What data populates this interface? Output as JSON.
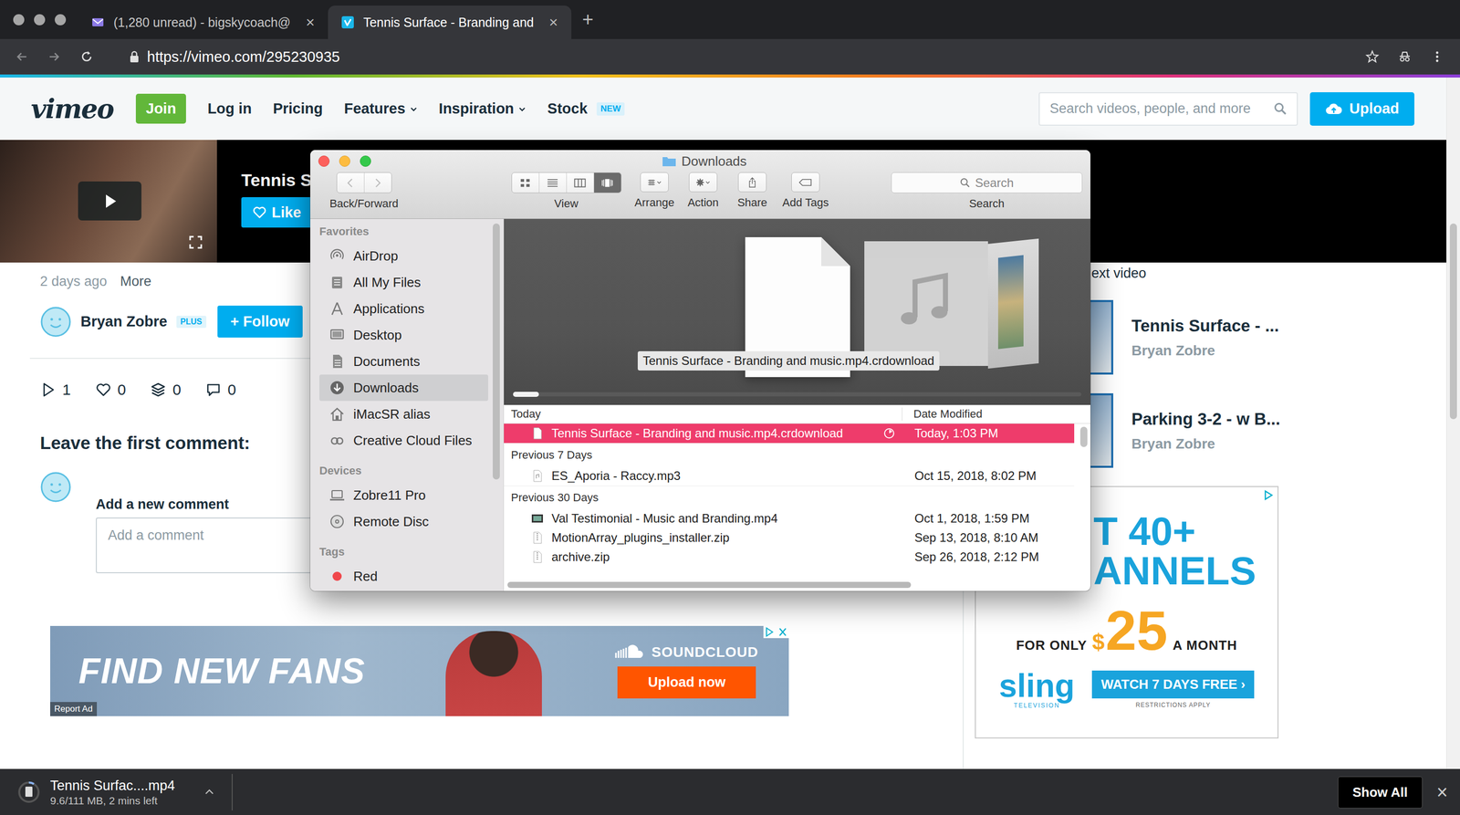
{
  "browser": {
    "tabs": [
      {
        "label": "(1,280 unread) - bigskycoach@",
        "close": "×",
        "kind": "mail",
        "selected": false
      },
      {
        "label": "Tennis Surface - Branding and",
        "close": "×",
        "kind": "vimeo",
        "selected": true
      }
    ],
    "new_tab": "+",
    "url": "https://vimeo.com/295230935"
  },
  "header": {
    "logo": "vimeo",
    "join": "Join",
    "nav": [
      {
        "label": "Log in",
        "dropdown": false
      },
      {
        "label": "Pricing",
        "dropdown": false
      },
      {
        "label": "Features",
        "dropdown": true
      },
      {
        "label": "Inspiration",
        "dropdown": true
      },
      {
        "label": "Stock",
        "dropdown": false,
        "badge": "NEW"
      }
    ],
    "search_placeholder": "Search videos, people, and more",
    "upload": "Upload"
  },
  "video": {
    "title": "Tennis S",
    "like": "Like"
  },
  "meta": {
    "posted": "2 days ago",
    "more": "More",
    "author": "Bryan Zobre",
    "badge": "PLUS",
    "follow_icon": "+",
    "follow": "Follow"
  },
  "stats": [
    {
      "kind": "plays",
      "count": "1"
    },
    {
      "kind": "likes",
      "count": "0"
    },
    {
      "kind": "collections",
      "count": "0"
    },
    {
      "kind": "comments",
      "count": "0"
    }
  ],
  "comments": {
    "heading": "Leave the first comment:",
    "label": "Add a new comment",
    "placeholder": "Add a comment"
  },
  "ad_banner": {
    "headline": "FIND NEW FANS",
    "brand": "SOUNDCLOUD",
    "cta": "Upload now",
    "report": "Report Ad"
  },
  "sidebar_right": {
    "label": "ext video",
    "related": [
      {
        "title": "Tennis Surface - ...",
        "author": "Bryan Zobre"
      },
      {
        "title": "Parking 3-2 - w B...",
        "author": "Bryan Zobre"
      }
    ]
  },
  "ad_side": {
    "line1": "T 40+",
    "line2": "ANNELS",
    "pre": "FOR ONLY",
    "currency": "$",
    "price": "25",
    "post": "A MONTH",
    "brand": "sling",
    "brand_sub": "TELEVISION",
    "cta": "WATCH 7 DAYS FREE",
    "cta_arrow": "›",
    "fine_print": "RESTRICTIONS APPLY"
  },
  "finder": {
    "title": "Downloads",
    "toolbar": {
      "back_forward": "Back/Forward",
      "view": "View",
      "view_modes": [
        {
          "mode": "icons",
          "selected": false
        },
        {
          "mode": "list",
          "selected": false
        },
        {
          "mode": "columns",
          "selected": false
        },
        {
          "mode": "coverflow",
          "selected": true
        }
      ],
      "arrange": "Arrange",
      "action": "Action",
      "share": "Share",
      "add_tags": "Add Tags",
      "search_placeholder": "Search",
      "search": "Search"
    },
    "sidebar": [
      {
        "heading": "Favorites",
        "items": [
          {
            "label": "AirDrop",
            "kind": "airdrop",
            "selected": false
          },
          {
            "label": "All My Files",
            "kind": "files",
            "selected": false
          },
          {
            "label": "Applications",
            "kind": "apps",
            "selected": false
          },
          {
            "label": "Desktop",
            "kind": "desktop",
            "selected": false
          },
          {
            "label": "Documents",
            "kind": "documents",
            "selected": false
          },
          {
            "label": "Downloads",
            "kind": "downloads",
            "selected": true
          },
          {
            "label": "iMacSR alias",
            "kind": "home",
            "selected": false
          },
          {
            "label": "Creative Cloud Files",
            "kind": "cloud",
            "selected": false
          }
        ]
      },
      {
        "heading": "Devices",
        "items": [
          {
            "label": "Zobre11 Pro",
            "kind": "laptop",
            "selected": false
          },
          {
            "label": "Remote Disc",
            "kind": "disc",
            "selected": false
          }
        ]
      },
      {
        "heading": "Tags",
        "items": [
          {
            "label": "Red",
            "kind": "tag",
            "color": "#f0474b",
            "selected": false
          }
        ]
      }
    ],
    "coverflow": {
      "caption": "Tennis Surface - Branding and music.mp4.crdownload",
      "items": [
        {
          "kind": "document",
          "selected": true
        },
        {
          "kind": "audio",
          "selected": false
        },
        {
          "kind": "video",
          "selected": false
        }
      ]
    },
    "date_column": "Date Modified",
    "groups": [
      {
        "label": "Today",
        "sticky": true,
        "rows": [
          {
            "name": "Tennis Surface - Branding and music.mp4.crdownload",
            "date": "Today, 1:03 PM",
            "kind": "download",
            "selected": true,
            "in_progress": true
          }
        ]
      },
      {
        "label": "Previous 7 Days",
        "sticky": false,
        "rows": [
          {
            "name": "ES_Aporia - Raccy.mp3",
            "date": "Oct 15, 2018, 8:02 PM",
            "kind": "audio",
            "selected": false,
            "in_progress": false
          }
        ]
      },
      {
        "label": "Previous 30 Days",
        "sticky": false,
        "rows": [
          {
            "name": "Val Testimonial - Music and Branding.mp4",
            "date": "Oct 1, 2018, 1:59 PM",
            "kind": "video",
            "selected": false,
            "in_progress": false
          },
          {
            "name": "MotionArray_plugins_installer.zip",
            "date": "Sep 13, 2018, 8:10 AM",
            "kind": "zip",
            "selected": false,
            "in_progress": false
          },
          {
            "name": "archive.zip",
            "date": "Sep 26, 2018, 2:12 PM",
            "kind": "zip",
            "selected": false,
            "in_progress": false
          }
        ]
      }
    ]
  },
  "download_bar": {
    "file": "Tennis Surfac....mp4",
    "status": "9.6/111 MB, 2 mins left",
    "level": 0.086,
    "show_all": "Show All",
    "close": "×"
  }
}
